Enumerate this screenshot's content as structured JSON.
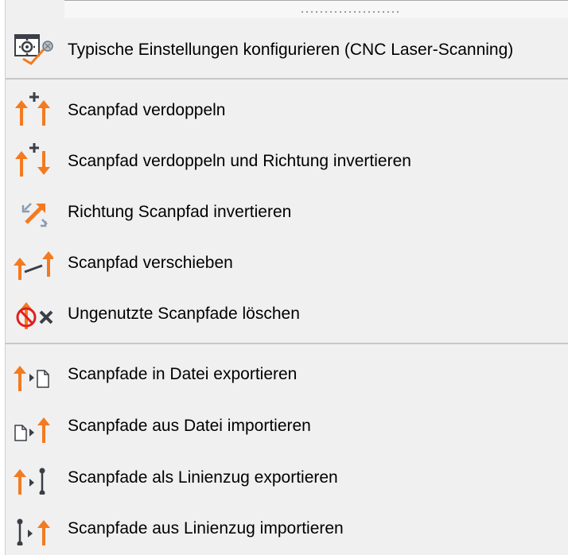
{
  "menu": {
    "items": [
      {
        "icon": "settings-window-icon",
        "label": "Typische Einstellungen konfigurieren (CNC Laser-Scanning)"
      },
      {
        "icon": "duplicate-scanpath-icon",
        "label": "Scanpfad verdoppeln"
      },
      {
        "icon": "duplicate-invert-scanpath-icon",
        "label": "Scanpfad verdoppeln und Richtung invertieren"
      },
      {
        "icon": "invert-direction-icon",
        "label": "Richtung Scanpfad invertieren"
      },
      {
        "icon": "move-scanpath-icon",
        "label": "Scanpfad verschieben"
      },
      {
        "icon": "delete-unused-scanpaths-icon",
        "label": "Ungenutzte Scanpfade löschen"
      },
      {
        "icon": "export-to-file-icon",
        "label": "Scanpfade in Datei exportieren"
      },
      {
        "icon": "import-from-file-icon",
        "label": "Scanpfade aus Datei importieren"
      },
      {
        "icon": "export-polyline-icon",
        "label": "Scanpfade als Linienzug exportieren"
      },
      {
        "icon": "import-polyline-icon",
        "label": "Scanpfade aus Linienzug importieren"
      }
    ]
  },
  "colors": {
    "accent_orange": "#f47a20",
    "icon_dark": "#3a3f47",
    "delete_red": "#e02020",
    "menu_bg": "#f0f0f0"
  }
}
